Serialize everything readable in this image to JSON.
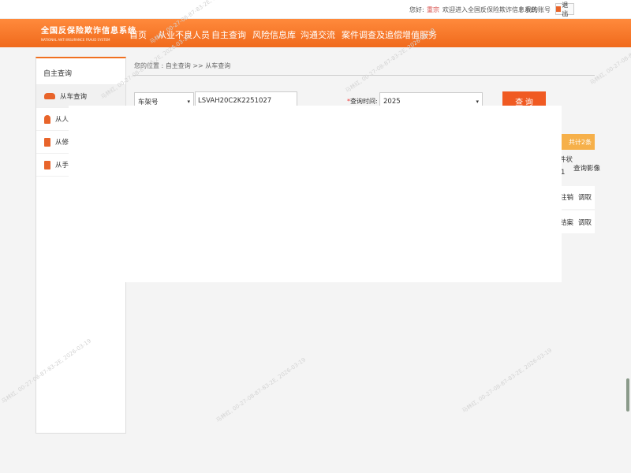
{
  "topbar": {
    "greeting_prefix": "您好:",
    "username": "重宗",
    "welcome": "欢迎进入全国反保险欺诈信息系统",
    "separator": "|",
    "my_account": "我的账号",
    "logout": "退出"
  },
  "brand": {
    "title_cn": "全国反保险欺诈信息系统",
    "title_en": "NATIONAL ANTI INSURANCE FRAUD SYSTEM",
    "colors": {
      "primary": "#f07020",
      "button": "#f05a22",
      "result_header": "#f6b04a"
    }
  },
  "nav": [
    "首页",
    "从业不良人员",
    "自主查询",
    "风险信息库",
    "沟通交流",
    "案件调查及追偿",
    "增值服务"
  ],
  "sidebar": {
    "header": "自主查询",
    "items": [
      {
        "label": "从车查询",
        "icon": "car-icon"
      },
      {
        "label": "从人查询",
        "icon": "person-icon"
      },
      {
        "label": "从修理厂查询",
        "icon": "phone-icon"
      },
      {
        "label": "从手机号查询",
        "icon": "phone-icon"
      }
    ],
    "visible_labels": [
      "从车查询",
      "从人查",
      "从修理",
      "从手机"
    ]
  },
  "breadcrumb": "您的位置 : 自主查询 >> 从车查询",
  "search": {
    "field_select": "车架号",
    "vin_value": "LSVAH20C2K2251027",
    "time_required_mark": "*",
    "time_label": "查询时间:",
    "year": "2025",
    "query_button": "查 询"
  },
  "results": {
    "count_text": "共计2条",
    "col_status_top": "件状",
    "col_status_bottom": "1",
    "col_images": "查询影像",
    "rows": [
      {
        "status": "注销",
        "action": "调取"
      },
      {
        "status": "结案",
        "action": "调取"
      }
    ]
  },
  "watermark_text": "马林红, 00-27-08-87-83-2E, 2026-03-19"
}
